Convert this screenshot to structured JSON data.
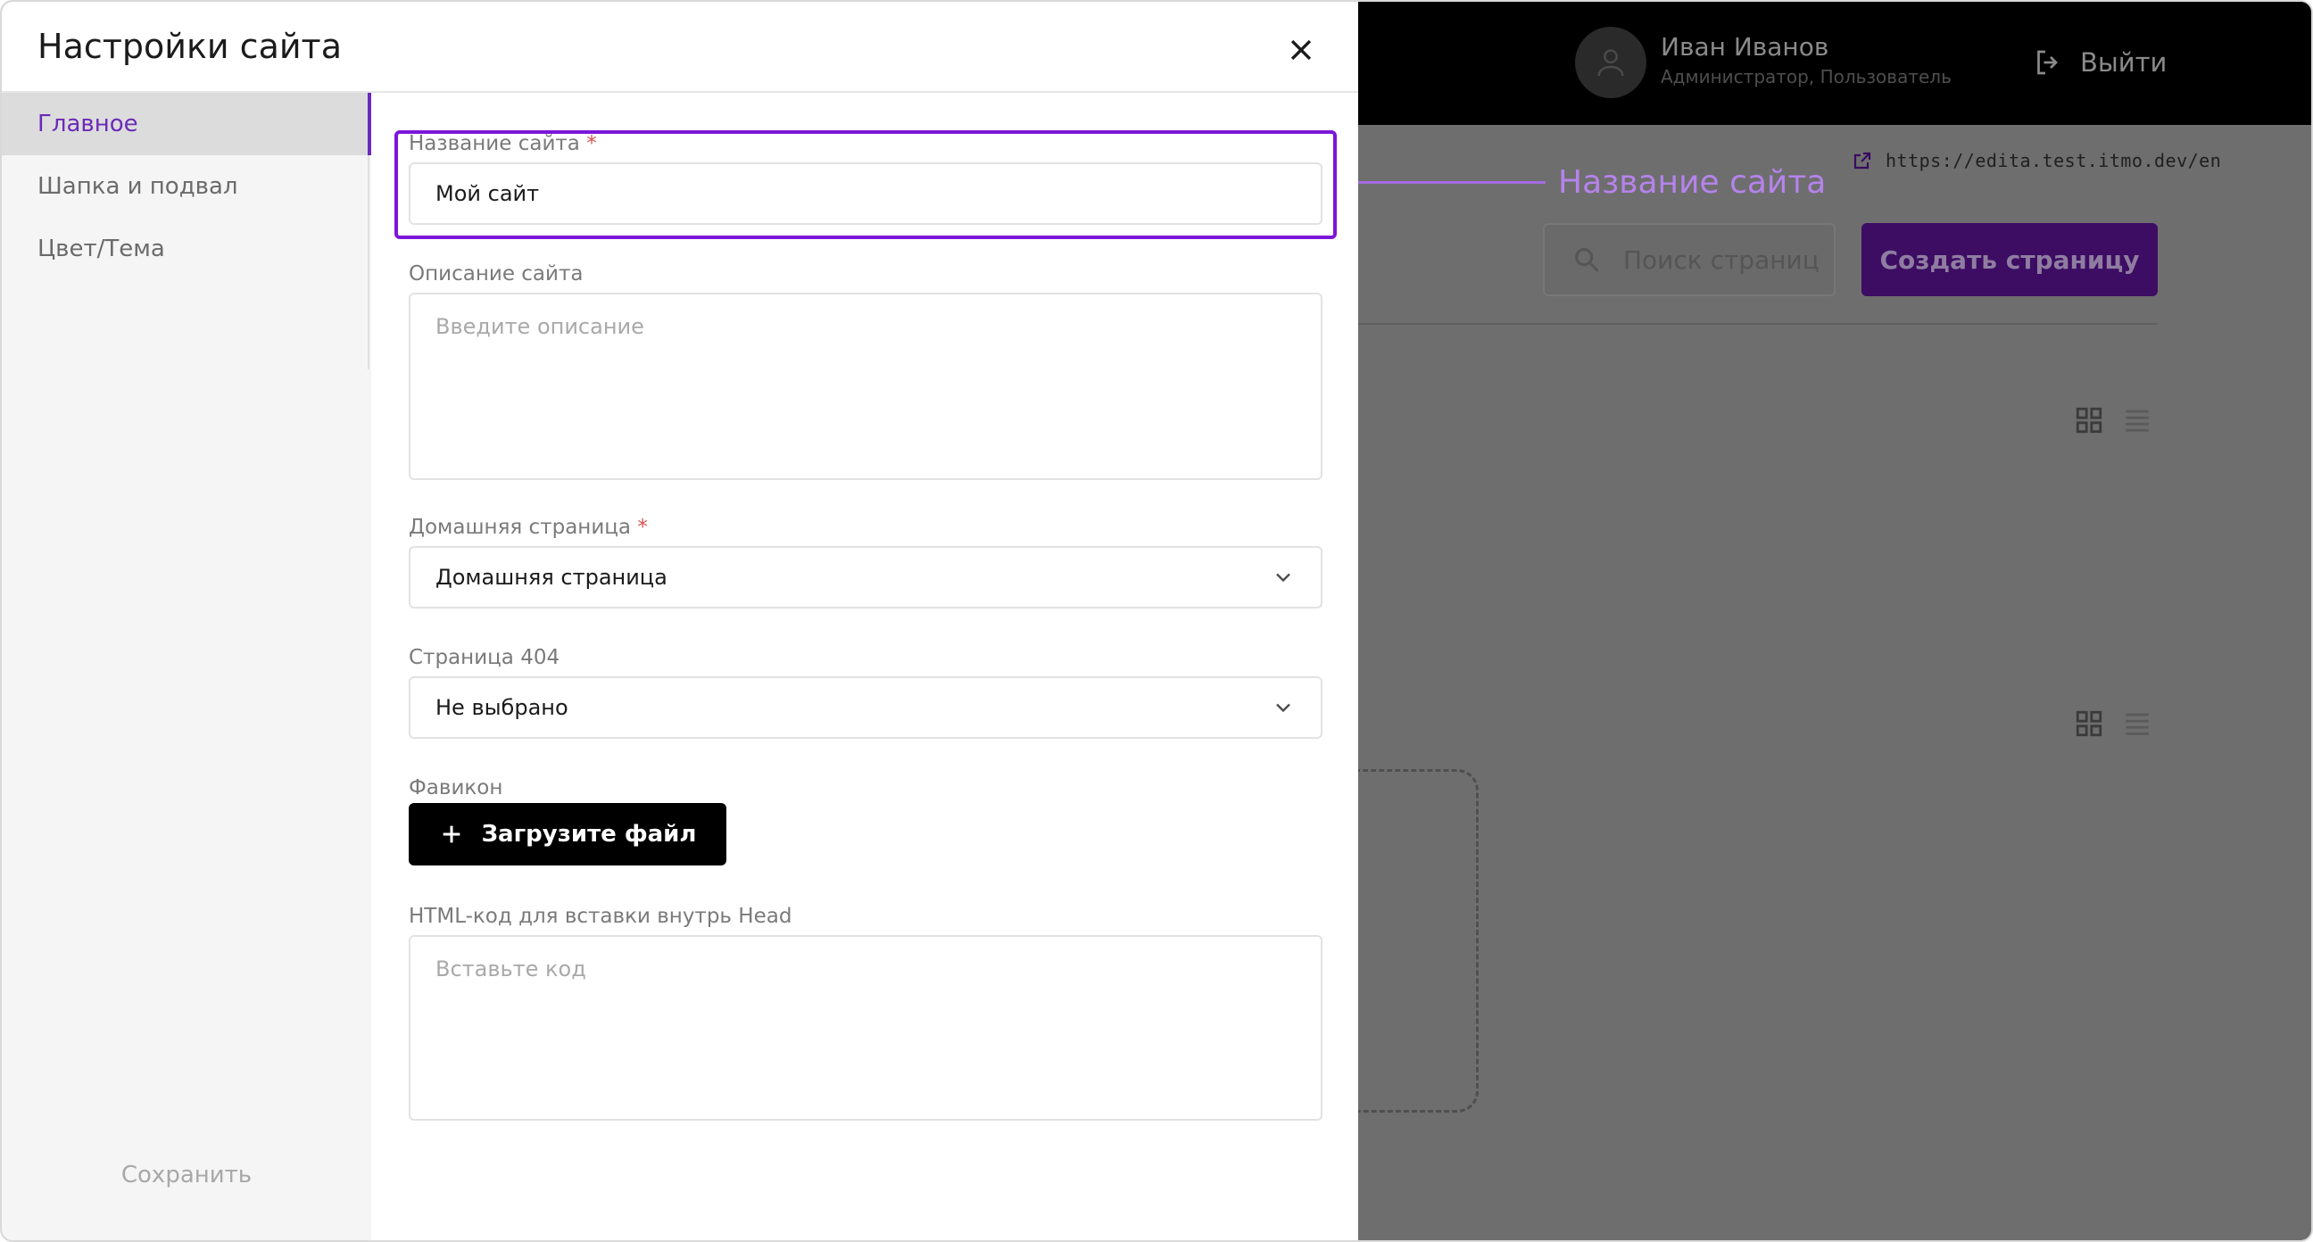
{
  "modal": {
    "title": "Настройки сайта",
    "sidebar": {
      "items": [
        {
          "label": "Главное",
          "active": true
        },
        {
          "label": "Шапка и подвал",
          "active": false
        },
        {
          "label": "Цвет/Тема",
          "active": false
        }
      ],
      "save_label": "Сохранить"
    },
    "form": {
      "site_name": {
        "label": "Название сайта",
        "required_mark": "*",
        "value": "Мой сайт"
      },
      "site_description": {
        "label": "Описание сайта",
        "placeholder": "Введите описание"
      },
      "home_page": {
        "label": "Домашняя страница",
        "required_mark": "*",
        "selected": "Домашняя страница"
      },
      "page_404": {
        "label": "Страница 404",
        "selected": "Не выбрано"
      },
      "favicon": {
        "label": "Фавикон",
        "upload_label": "Загрузите файл"
      },
      "head_html": {
        "label": "HTML-код для вставки внутрь Head",
        "placeholder": "Вставьте код"
      }
    }
  },
  "callout": {
    "label": "Название сайта"
  },
  "background": {
    "user": {
      "name": "Иван Иванов",
      "roles": "Администратор, Пользователь"
    },
    "logout_label": "Выйти",
    "site_url": "https://edita.test.itmo.dev/en",
    "search_placeholder": "Поиск страниц",
    "create_label": "Создать страницу"
  },
  "colors": {
    "accent": "#7b16d8",
    "active_text": "#6b2ab8",
    "callout": "#b583ec",
    "overlay": "#6e6e6e"
  }
}
